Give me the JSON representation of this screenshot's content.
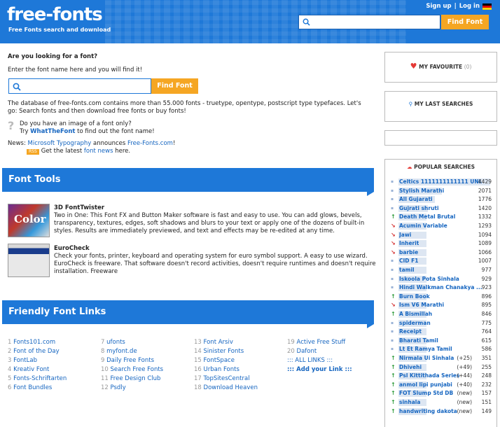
{
  "header": {
    "logo": "free-fonts",
    "tagline": "Free Fonts search and download",
    "signup": "Sign up",
    "sep": "|",
    "login": "Log in",
    "search_button": "Find Font"
  },
  "main": {
    "question": "Are you looking for a font?",
    "prompt": "Enter the font name here and you will find it!",
    "search_button": "Find Font",
    "description": "The database of free-fonts.com contains more than 55.000 fonts - truetype, opentype, postscript type typefaces. Let's go: Search fonts and then download free fonts or buy fonts!",
    "image_q": "Do you have an image of a font only?",
    "try_pre": "Try ",
    "try_link": "WhatTheFont",
    "try_post": " to find out the font name!",
    "news_label": "News: ",
    "news_link1": "Microsoft Typography",
    "news_mid": " announces ",
    "news_link2": "Free-Fonts.com",
    "news_end": "!",
    "rss_badge": "RSS",
    "latest_pre": "Get the latest ",
    "latest_link": "font news",
    "latest_post": " here."
  },
  "tools": {
    "title": "Font Tools",
    "items": [
      {
        "name": "3D FontTwister",
        "desc": "Two in One: This Font FX and Button Maker software is fast and easy to use. You can add glows, bevels, transparency, textures, edges, soft shadows and blurs to your text or apply one of the dozens of built-in styles. Results are immediately previewed, and text and effects may be re-edited at any time.",
        "thumb_text": "Color"
      },
      {
        "name": "EuroCheck",
        "desc": "Check your fonts, printer, keyboard and operating system for euro symbol support. A easy to use wizard. EuroCheck is freeware. That software doesn't record activities, doesn't require runtimes and doesn't require installation. Freeware"
      }
    ]
  },
  "friendly": {
    "title": "Friendly Font Links",
    "col1": [
      {
        "n": "1",
        "t": "Fonts101.com"
      },
      {
        "n": "2",
        "t": "Font of the Day"
      },
      {
        "n": "3",
        "t": "FontLab"
      },
      {
        "n": "4",
        "t": "Kreativ Font"
      },
      {
        "n": "5",
        "t": "Fonts-Schriftarten"
      },
      {
        "n": "6",
        "t": "Font Bundles"
      }
    ],
    "col2": [
      {
        "n": "7",
        "t": "ufonts"
      },
      {
        "n": "8",
        "t": "myfont.de"
      },
      {
        "n": "9",
        "t": "Daily Free Fonts"
      },
      {
        "n": "10",
        "t": "Search Free Fonts"
      },
      {
        "n": "11",
        "t": "Free Design Club"
      },
      {
        "n": "12",
        "t": "Psdly"
      }
    ],
    "col3": [
      {
        "n": "13",
        "t": "Font Arsiv"
      },
      {
        "n": "14",
        "t": "Sinister Fonts"
      },
      {
        "n": "15",
        "t": "FontSpace"
      },
      {
        "n": "16",
        "t": "Urban Fonts"
      },
      {
        "n": "17",
        "t": "TopSitesCentral"
      },
      {
        "n": "18",
        "t": "Download Heaven"
      }
    ],
    "col4": [
      {
        "n": "19",
        "t": "Active Free Stuff"
      },
      {
        "n": "20",
        "t": "Dafont"
      },
      {
        "n": "",
        "t": "::: ALL LINKS :::"
      },
      {
        "n": "",
        "t": "::: Add your Link :::"
      }
    ]
  },
  "sidebar": {
    "favourite": "MY FAVOURITE",
    "favourite_count": "(0)",
    "last_searches": "MY LAST SEARCHES",
    "popular": "POPULAR SEARCHES",
    "searches": [
      {
        "label": "Celtics 1111111111111 UNI...",
        "count": "4429",
        "trend": "",
        "change": "",
        "fill": 1.0
      },
      {
        "label": "Stylish Marathi",
        "count": "2071",
        "trend": "",
        "change": "",
        "fill": 0.47
      },
      {
        "label": "All Gujarati",
        "count": "1776",
        "trend": "",
        "change": "",
        "fill": 0.4
      },
      {
        "label": "Gujrati shruti",
        "count": "1420",
        "trend": "",
        "change": "",
        "fill": 0.32
      },
      {
        "label": "Death Metal Brutal",
        "count": "1332",
        "trend": "up",
        "change": "",
        "fill": 0.3
      },
      {
        "label": "Acumin Variable",
        "count": "1293",
        "trend": "down",
        "change": "",
        "fill": 0.29
      },
      {
        "label": "Jawi",
        "count": "1094",
        "trend": "down",
        "change": "",
        "fill": 0.25
      },
      {
        "label": "Inherit",
        "count": "1089",
        "trend": "down",
        "change": "",
        "fill": 0.25
      },
      {
        "label": "barbie",
        "count": "1066",
        "trend": "down",
        "change": "",
        "fill": 0.24
      },
      {
        "label": "CID F1",
        "count": "1007",
        "trend": "",
        "change": "",
        "fill": 0.23
      },
      {
        "label": "tamil",
        "count": "977",
        "trend": "",
        "change": "",
        "fill": 0.22
      },
      {
        "label": "Iskoola Pota Sinhala",
        "count": "929",
        "trend": "",
        "change": "",
        "fill": 0.21
      },
      {
        "label": "Hindi Walkman Chanakya ...",
        "count": "923",
        "trend": "",
        "change": "",
        "fill": 0.21
      },
      {
        "label": "Burn Book",
        "count": "896",
        "trend": "up",
        "change": "",
        "fill": 0.2
      },
      {
        "label": "Ism V6 Marathi",
        "count": "895",
        "trend": "down",
        "change": "",
        "fill": 0.2
      },
      {
        "label": "A Bismillah",
        "count": "846",
        "trend": "up",
        "change": "",
        "fill": 0.19
      },
      {
        "label": "spiderman",
        "count": "775",
        "trend": "",
        "change": "",
        "fill": 0.17
      },
      {
        "label": "Receipt",
        "count": "764",
        "trend": "",
        "change": "",
        "fill": 0.17
      },
      {
        "label": "Bharati Tamil",
        "count": "615",
        "trend": "",
        "change": "",
        "fill": 0.14
      },
      {
        "label": "Lt Et Ramya Tamil",
        "count": "586",
        "trend": "",
        "change": "",
        "fill": 0.13
      },
      {
        "label": "Nirmala Ui Sinhala",
        "count": "351",
        "trend": "up",
        "change": "(+25)",
        "fill": 0.08
      },
      {
        "label": "Dhivehi",
        "count": "255",
        "trend": "up",
        "change": "(+49)",
        "fill": 0.06
      },
      {
        "label": "Psl Kittithada Series",
        "count": "248",
        "trend": "up",
        "change": "(+44)",
        "fill": 0.06
      },
      {
        "label": "anmol lipi punjabi",
        "count": "232",
        "trend": "up",
        "change": "(+40)",
        "fill": 0.05
      },
      {
        "label": "FOT Slump Std DB",
        "count": "157",
        "trend": "up",
        "change": "(new)",
        "fill": 0.04
      },
      {
        "label": "sinhala",
        "count": "151",
        "trend": "up",
        "change": "(new)",
        "fill": 0.03
      },
      {
        "label": "handwriting dakota",
        "count": "149",
        "trend": "up",
        "change": "(new)",
        "fill": 0.03
      }
    ]
  },
  "colors": {
    "brand": "#1e78d8",
    "button": "#f5a623",
    "up": "#2e9b3a",
    "down": "#d32f2f"
  }
}
